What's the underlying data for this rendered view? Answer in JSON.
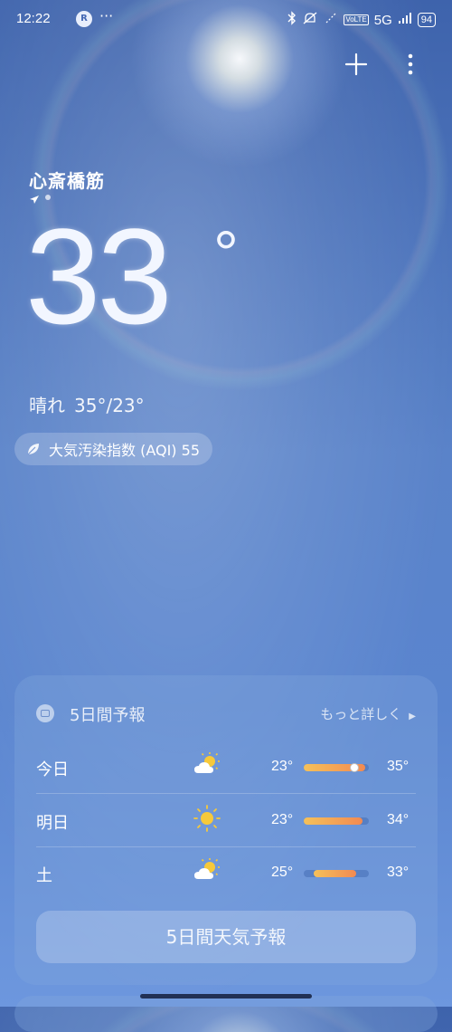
{
  "status_bar": {
    "time": "12:22",
    "notif_badge": "R",
    "more_dots": "···",
    "network": "5G",
    "volte": "VoLTE",
    "battery": "94"
  },
  "location": "心斎橋筋",
  "current": {
    "temperature": "33",
    "degree_symbol": "°",
    "condition": "晴れ",
    "high_low": "35°/23°"
  },
  "aqi": {
    "label": "大気汚染指数 (AQI) 55"
  },
  "forecast": {
    "title": "5日間予報",
    "more_label": "もっと詳しく",
    "days": [
      {
        "day": "今日",
        "icon": "partly-cloudy-icon",
        "low": "23°",
        "high": "35°",
        "bar_start": 0.0,
        "bar_end": 0.95,
        "current_pos": 0.78
      },
      {
        "day": "明日",
        "icon": "sunny-icon",
        "low": "23°",
        "high": "34°",
        "bar_start": 0.0,
        "bar_end": 0.9
      },
      {
        "day": "土",
        "icon": "partly-cloudy-icon",
        "low": "25°",
        "high": "33°",
        "bar_start": 0.15,
        "bar_end": 0.8
      }
    ],
    "button_label": "5日間天気予報"
  },
  "colors": {
    "sky_top": "#3e63ac",
    "sky_bottom": "#6d97de",
    "bar_warm_start": "#f5c15a",
    "bar_warm_end": "#f28a52",
    "sun": "#f7c93a"
  }
}
